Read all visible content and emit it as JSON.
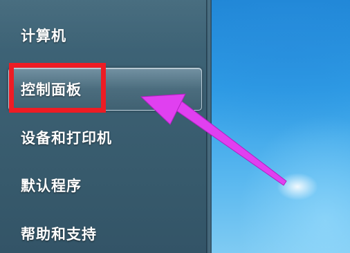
{
  "start_menu": {
    "items": [
      {
        "label": "计算机"
      },
      {
        "label": "控制面板"
      },
      {
        "label": "设备和打印机"
      },
      {
        "label": "默认程序"
      },
      {
        "label": "帮助和支持"
      }
    ]
  },
  "colors": {
    "pane": "#3b5f72",
    "highlight_box": "#ee1c24",
    "arrow": "#e040f0",
    "desktop": "#2f9de6"
  },
  "icons": {
    "arrow": "pointer-arrow-annotation"
  }
}
